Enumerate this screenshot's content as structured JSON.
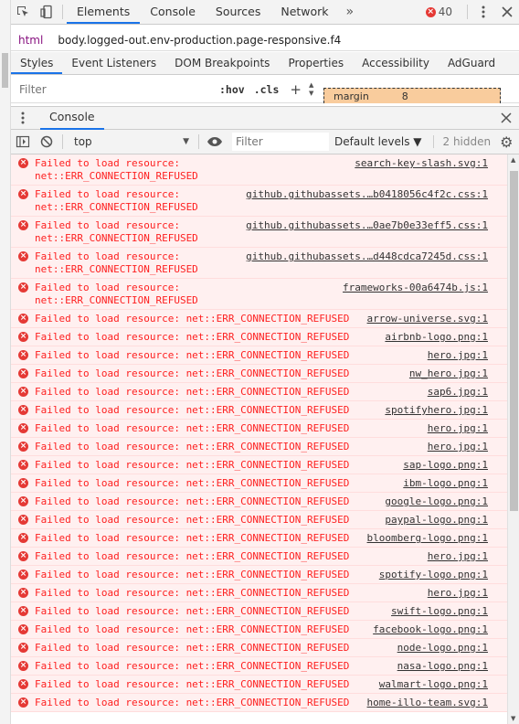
{
  "toolbar": {
    "tabs": [
      "Elements",
      "Console",
      "Sources",
      "Network"
    ],
    "active_tab": "Elements",
    "more_tabs": "»",
    "error_count": "40"
  },
  "breadcrumb": {
    "html": "html",
    "body": "body.logged-out.env-production.page-responsive.f4"
  },
  "subtabs": [
    "Styles",
    "Event Listeners",
    "DOM Breakpoints",
    "Properties",
    "Accessibility",
    "AdGuard"
  ],
  "styles": {
    "filter_placeholder": "Filter",
    "hov": ":hov",
    "cls": ".cls",
    "margin_label": "margin",
    "margin_value": "8"
  },
  "drawer": {
    "tab": "Console"
  },
  "console_toolbar": {
    "context": "top",
    "filter_placeholder": "Filter",
    "levels": "Default levels ▼",
    "hidden": "2 hidden"
  },
  "messages": [
    {
      "text": "Failed to load resource:\nnet::ERR_CONNECTION_REFUSED",
      "src": "search-key-slash.svg:1"
    },
    {
      "text": "Failed to load resource:\nnet::ERR_CONNECTION_REFUSED",
      "src": "github.githubassets.…b0418056c4f2c.css:1"
    },
    {
      "text": "Failed to load resource:\nnet::ERR_CONNECTION_REFUSED",
      "src": "github.githubassets.…0ae7b0e33eff5.css:1"
    },
    {
      "text": "Failed to load resource:\nnet::ERR_CONNECTION_REFUSED",
      "src": "github.githubassets.…d448cdca7245d.css:1"
    },
    {
      "text": "Failed to load resource:\nnet::ERR_CONNECTION_REFUSED",
      "src": "frameworks-00a6474b.js:1"
    },
    {
      "text": "Failed to load resource: net::ERR_CONNECTION_REFUSED",
      "src": "arrow-universe.svg:1"
    },
    {
      "text": "Failed to load resource: net::ERR_CONNECTION_REFUSED",
      "src": "airbnb-logo.png:1"
    },
    {
      "text": "Failed to load resource: net::ERR_CONNECTION_REFUSED",
      "src": "hero.jpg:1"
    },
    {
      "text": "Failed to load resource: net::ERR_CONNECTION_REFUSED",
      "src": "nw_hero.jpg:1"
    },
    {
      "text": "Failed to load resource: net::ERR_CONNECTION_REFUSED",
      "src": "sap6.jpg:1"
    },
    {
      "text": "Failed to load resource: net::ERR_CONNECTION_REFUSED",
      "src": "spotifyhero.jpg:1"
    },
    {
      "text": "Failed to load resource: net::ERR_CONNECTION_REFUSED",
      "src": "hero.jpg:1"
    },
    {
      "text": "Failed to load resource: net::ERR_CONNECTION_REFUSED",
      "src": "hero.jpg:1"
    },
    {
      "text": "Failed to load resource: net::ERR_CONNECTION_REFUSED",
      "src": "sap-logo.png:1"
    },
    {
      "text": "Failed to load resource: net::ERR_CONNECTION_REFUSED",
      "src": "ibm-logo.png:1"
    },
    {
      "text": "Failed to load resource: net::ERR_CONNECTION_REFUSED",
      "src": "google-logo.png:1"
    },
    {
      "text": "Failed to load resource: net::ERR_CONNECTION_REFUSED",
      "src": "paypal-logo.png:1"
    },
    {
      "text": "Failed to load resource: net::ERR_CONNECTION_REFUSED",
      "src": "bloomberg-logo.png:1"
    },
    {
      "text": "Failed to load resource: net::ERR_CONNECTION_REFUSED",
      "src": "hero.jpg:1"
    },
    {
      "text": "Failed to load resource: net::ERR_CONNECTION_REFUSED",
      "src": "spotify-logo.png:1"
    },
    {
      "text": "Failed to load resource: net::ERR_CONNECTION_REFUSED",
      "src": "hero.jpg:1"
    },
    {
      "text": "Failed to load resource: net::ERR_CONNECTION_REFUSED",
      "src": "swift-logo.png:1"
    },
    {
      "text": "Failed to load resource: net::ERR_CONNECTION_REFUSED",
      "src": "facebook-logo.png:1"
    },
    {
      "text": "Failed to load resource: net::ERR_CONNECTION_REFUSED",
      "src": "node-logo.png:1"
    },
    {
      "text": "Failed to load resource: net::ERR_CONNECTION_REFUSED",
      "src": "nasa-logo.png:1"
    },
    {
      "text": "Failed to load resource: net::ERR_CONNECTION_REFUSED",
      "src": "walmart-logo.png:1"
    },
    {
      "text": "Failed to load resource: net::ERR_CONNECTION_REFUSED",
      "src": "home-illo-team.svg:1"
    }
  ]
}
